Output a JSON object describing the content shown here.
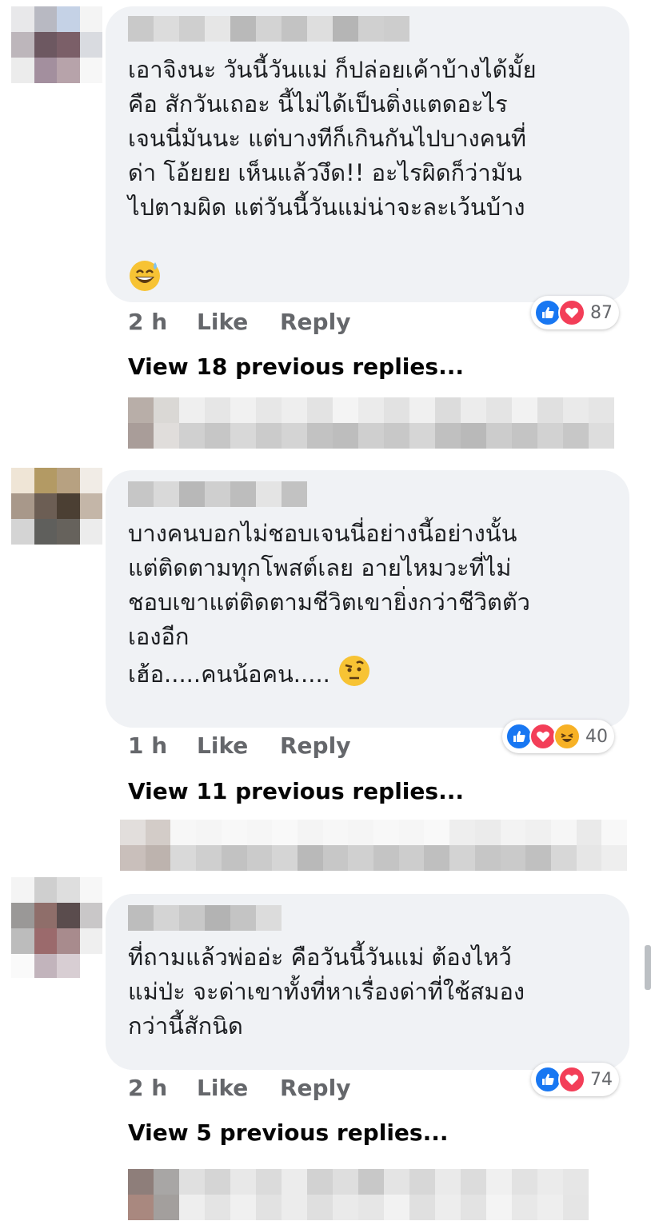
{
  "comments": [
    {
      "text": "เอาจิงนะ วันนี้วันแม่ ก็ปล่อยเค้าบ้างได้มั้ย\nคือ สักวันเถอะ นี้ไม่ได้เป็นติ่งแตดอะไร\nเจนนี่มันนะ แต่บางทีก็เกินกันไปบางคนที่\nด่า โอ้ยยย เห็นแล้วงึด!! อะไรผิดก็ว่ามัน\nไปตามผิด แต่วันนี้วันแม่น่าจะละเว้นบ้าง",
      "emoji": "grinning-sweat-emoji",
      "time": "2 h",
      "like_label": "Like",
      "reply_label": "Reply",
      "reactions": [
        "like",
        "love"
      ],
      "reaction_count": "87",
      "view_replies": "View 18 previous replies..."
    },
    {
      "text": "บางคนบอกไม่ชอบเจนนี่อย่างนี้อย่างนั้น\nแต่ติดตามทุกโพสต์เลย อายไหมวะที่ไม่\nชอบเขาแต่ติดตามชีวิตเขายิ่งกว่าชีวิตตัว\nเองอีก\nเฮ้อ.....คนน้อคน.....",
      "emoji": "raised-eyebrow-emoji",
      "time": "1 h",
      "like_label": "Like",
      "reply_label": "Reply",
      "reactions": [
        "like",
        "love",
        "haha"
      ],
      "reaction_count": "40",
      "view_replies": "View 11 previous replies..."
    },
    {
      "text": "ที่ถามแล้วพ่ออ่ะ คือวันนี้วันแม่ ต้องไหว้\nแม่ป่ะ จะด่าเขาทั้งที่หาเรื่องด่าที่ใช้สมอง\nกว่านี้สักนิด",
      "emoji": "",
      "time": "2 h",
      "like_label": "Like",
      "reply_label": "Reply",
      "reactions": [
        "like",
        "love"
      ],
      "reaction_count": "74",
      "view_replies": "View 5 previous replies..."
    }
  ],
  "colors": {
    "bubble": "#f0f2f5",
    "meta_text": "#65676b",
    "like_blue": "#1877f2",
    "love_red": "#f33e58",
    "haha_yellow": "#f7b125"
  }
}
